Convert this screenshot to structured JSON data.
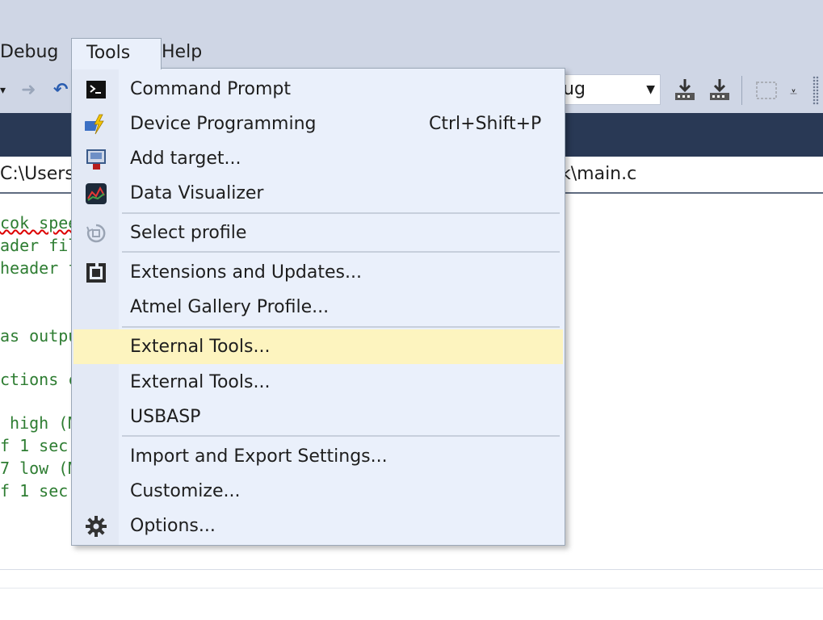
{
  "menubar": {
    "debug": "Debug",
    "tools": "Tools",
    "help": "Help"
  },
  "toolbar": {
    "config_value": "ug"
  },
  "pathbar": {
    "left_text": "C:\\Users",
    "right_text": "k\\main.c"
  },
  "code_lines": [
    "cok spee",
    "ader fil",
    "header f",
    "as outpu",
    "ctions c",
    " high (M",
    "f 1 sec",
    "7 low (M",
    "f 1 sec"
  ],
  "tools_menu": {
    "items": [
      {
        "label": "Command Prompt",
        "icon": "command-prompt-icon"
      },
      {
        "label": "Device Programming",
        "shortcut": "Ctrl+Shift+P",
        "icon": "device-programming-icon"
      },
      {
        "label": "Add target...",
        "icon": "add-target-icon"
      },
      {
        "label": "Data Visualizer",
        "icon": "data-visualizer-icon"
      },
      {
        "label": "Select profile",
        "icon": "select-profile-icon"
      },
      {
        "label": "Extensions and Updates...",
        "icon": "extensions-icon"
      },
      {
        "label": "Atmel Gallery Profile..."
      },
      {
        "label": "External Tools...",
        "highlighted": true
      },
      {
        "label": "External Tools..."
      },
      {
        "label": "USBASP"
      },
      {
        "label": "Import and Export Settings..."
      },
      {
        "label": "Customize..."
      },
      {
        "label": "Options...",
        "icon": "gear-icon"
      }
    ]
  },
  "colors": {
    "menubar_bg": "#cfd6e5",
    "tabstrip_bg": "#293955",
    "menu_bg": "#eaf0fb",
    "highlight_bg": "#fdf4bf",
    "code_comment": "#2e7d32"
  }
}
